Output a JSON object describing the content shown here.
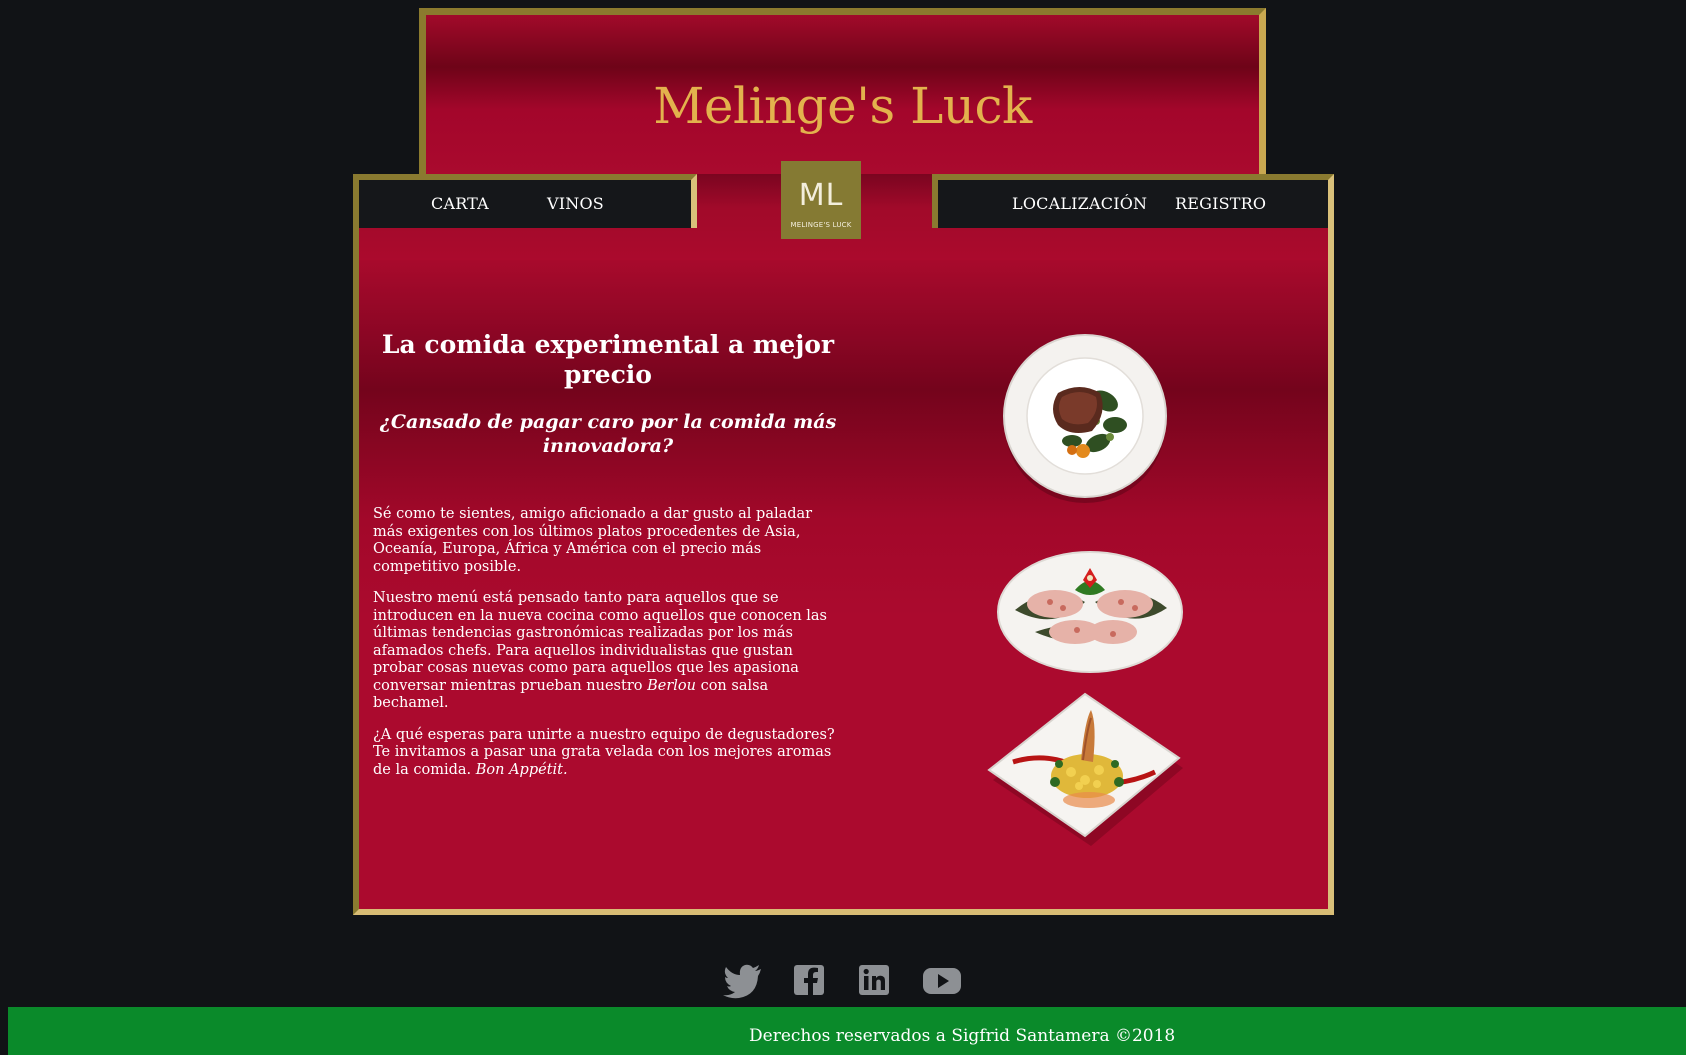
{
  "site": {
    "title": "Melinge's Luck"
  },
  "logo": {
    "mark": "ML",
    "sub": "MELINGE'S LUCK"
  },
  "nav": {
    "left": [
      "CARTA",
      "VINOS"
    ],
    "right": [
      "LOCALIZACIÓN",
      "REGISTRO"
    ]
  },
  "content": {
    "headline": "La comida experimental a mejor precio",
    "subheadline": "¿Cansado de pagar caro por la comida más innovadora?",
    "p1": "Sé como te sientes, amigo aficionado a dar gusto al paladar más exigentes con los últimos platos procedentes de Asia, Oceanía, Europa, África y América con el precio más competitivo posible.",
    "p2_before": "Nuestro menú está pensado tanto para aquellos que se introducen en la nueva cocina como aquellos que conocen las últimas tendencias gastronómicas realizadas por los más afamados chefs. Para aquellos individualistas que gustan probar cosas nuevas como para aquellos que les apasiona conversar mientras prueban nuestro ",
    "p2_em": "Berlou",
    "p2_after": " con salsa bechamel.",
    "p3_before": "¿A qué esperas para unirte a nuestro equipo de degustadores? Te invitamos a pasar una grata velada con los mejores aromas de la comida. ",
    "p3_em": "Bon Appétit."
  },
  "images": [
    "round-plate-steak",
    "oval-plate-tartare",
    "square-plate-seafood"
  ],
  "social": [
    "twitter-icon",
    "facebook-icon",
    "linkedin-icon",
    "youtube-icon"
  ],
  "footer": {
    "text": "Derechos reservados a Sigfrid Santamera ©2018"
  },
  "colors": {
    "background": "#111316",
    "crimson": "#aa0a2e",
    "gold": "#e3b24d",
    "footer": "#0a8a2a",
    "logo": "#857a33"
  }
}
